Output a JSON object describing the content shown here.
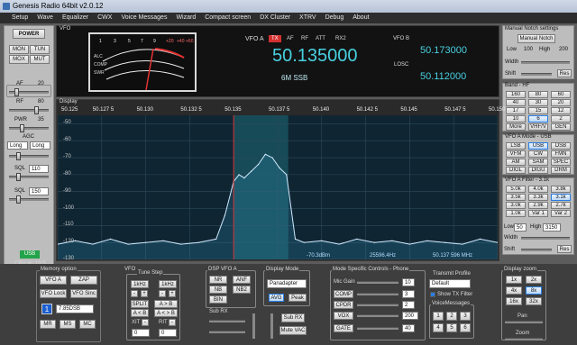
{
  "window": {
    "title": "Genesis Radio 64bit  v2.0.12"
  },
  "menu": [
    "Setup",
    "Wave",
    "Equalizer",
    "CWX",
    "Voice Messages",
    "Wizard",
    "Compact screen",
    "DX Cluster",
    "XTRV",
    "Debug",
    "About"
  ],
  "left": {
    "power": "POWER",
    "inputs": [
      "MON",
      "TUN",
      "MOX",
      "MUT"
    ],
    "af": {
      "label": "AF",
      "value": "20"
    },
    "rf": {
      "label": "RF",
      "value": "80"
    },
    "pwr": {
      "label": "PWR",
      "value": "35"
    },
    "agc": {
      "label": "AGC",
      "mode1": "Long",
      "mode2": "Long"
    },
    "sql1": {
      "label": "SQL",
      "value": "110"
    },
    "sql2": {
      "label": "SQL",
      "value": "150"
    },
    "usb": "USB",
    "cpu": "CPU %: 10.5"
  },
  "vfo": {
    "section": "VFO",
    "vfoa_label": "VFO A",
    "tx": "TX",
    "flags": [
      "AF",
      "RF",
      "ATT",
      "RX2"
    ],
    "vfoa_freq": "50.135000",
    "band": "6M SSB",
    "vfob_label": "VFO B",
    "vfob_freq": "50.173000",
    "losc_label": "LOSC",
    "losc_freq": "50.112000",
    "meter_scale_top": [
      "1",
      "3",
      "5",
      "7",
      "9",
      "+20",
      "+40",
      "+60"
    ],
    "meter_scale_side": [
      "ALC",
      "COMP",
      "SWR"
    ]
  },
  "display": {
    "label": "Display",
    "x_ticks": [
      "50.125",
      "50.127 5",
      "50.130",
      "50.132 5",
      "50.135",
      "50.137 5",
      "50.140",
      "50.142 5",
      "50.145",
      "50.147 5",
      "50.150"
    ],
    "y_ticks": [
      "-50",
      "-60",
      "-70",
      "-80",
      "-90",
      "-100",
      "-110",
      "-120",
      "-130"
    ],
    "readout_db": "-70.3dBm",
    "readout_offset": "25596.4Hz",
    "readout_freq": "50.137 596 MHz"
  },
  "chart_data": {
    "type": "area",
    "xlabel": "",
    "ylabel": "",
    "xlim": [
      50.125,
      50.15
    ],
    "ylim": [
      -130,
      -45
    ],
    "x": [
      50.125,
      50.126,
      50.127,
      50.128,
      50.129,
      50.13,
      50.131,
      50.132,
      50.133,
      50.134,
      50.1345,
      50.135,
      50.1353,
      50.1356,
      50.136,
      50.1364,
      50.1368,
      50.1372,
      50.1376,
      50.138,
      50.1385,
      50.139,
      50.14,
      50.141,
      50.142,
      50.143,
      50.144,
      50.145,
      50.146,
      50.147,
      50.148,
      50.149,
      50.15
    ],
    "y": [
      -121,
      -119,
      -121,
      -118,
      -121,
      -120,
      -119,
      -121,
      -120,
      -118,
      -104,
      -84,
      -80,
      -82,
      -78,
      -74,
      -68,
      -70,
      -76,
      -80,
      -118,
      -120,
      -119,
      -121,
      -118,
      -120,
      -119,
      -121,
      -119,
      -120,
      -121,
      -118,
      -120
    ],
    "series": [
      {
        "values": "y"
      }
    ]
  },
  "notch": {
    "title": "Manual Notch settings",
    "button": "Manual Notch",
    "low": "Low",
    "v100": "100",
    "high": "High",
    "v200": "200",
    "width": "Width",
    "shift": "Shift",
    "reset": "Res"
  },
  "band": {
    "title": "Band - HF",
    "items": [
      "160",
      "80",
      "60",
      "40",
      "30",
      "20",
      "17",
      "15",
      "12",
      "10",
      "6",
      "2",
      "More",
      "VHF/V",
      "GEN"
    ]
  },
  "mode": {
    "title": "VFO A Mode - USB",
    "items": [
      "LSB",
      "USB",
      "DSB",
      "VFM",
      "CW",
      "FMN",
      "AM",
      "SAM",
      "SPEC",
      "DIGL",
      "DIGU",
      "DRM"
    ]
  },
  "filter": {
    "title": "VFO A Filter - 3.1k",
    "items": [
      "5.0k",
      "4.0k",
      "3.8k",
      "3.5k",
      "3.3k",
      "3.1k",
      "3.0k",
      "2.9k",
      "2.7k",
      "1.0k",
      "Var 1",
      "Var 2"
    ],
    "low": "Low",
    "low_val": "50",
    "high": "High",
    "high_val": "3150",
    "width": "Width",
    "shift": "Shift",
    "reset": "Res"
  },
  "memory": {
    "title": "Memory option",
    "vfoa": "VFO A",
    "zap": "ZAP",
    "vfolock": "VFO Lock",
    "vfosinc": "VFO Sinc",
    "channel": "1",
    "mem_val": "7.85DSB",
    "mr": "MR",
    "ms": "MS",
    "mc": "MC"
  },
  "tune": {
    "title": "Tune Step",
    "vfo_label": "VFO",
    "step1": "1kHz",
    "step2": "1kHz",
    "minus": "-",
    "plus": "+",
    "split": "SPLIT",
    "atob": "A > B",
    "aeb": "A < B",
    "bta": "A < > B",
    "xit": "XIT",
    "rit": "RIT",
    "xit_val": "0",
    "rit_val": "0"
  },
  "dsp": {
    "title": "DSP VFO A",
    "nr": "NR",
    "anf": "ANF",
    "nb": "NB",
    "nb2": "NB2",
    "bin": "BIN",
    "subrx": "Sub RX",
    "subrx_btn": "Sub RX",
    "mutevac": "Mute VAC"
  },
  "dmode": {
    "title": "Display Mode",
    "value": "Panadapter",
    "avg": "AVG",
    "peak": "Peak"
  },
  "phone": {
    "title": "Mode Specific Controls - Phone",
    "mic": "Mic Gain",
    "mic_val": "10",
    "comp": "COMP",
    "comp_val": "3",
    "cpdr": "CPDR",
    "cpdr_val": "2",
    "vox": "VOX",
    "vox_val": "200",
    "gate": "GATE",
    "gate_val": "40",
    "tx_profile": "Transmit Profile",
    "profile": "Default",
    "show_tx": "Show TX Filter",
    "voice": "VoiceMessages",
    "voice_btns": [
      "1",
      "2",
      "3",
      "4",
      "5",
      "6"
    ]
  },
  "zoom": {
    "title": "Display zoom",
    "items": [
      "1x",
      "2x",
      "4x",
      "8x",
      "16x",
      "32x"
    ],
    "pan": "Pan",
    "zoom": "Zoom"
  }
}
